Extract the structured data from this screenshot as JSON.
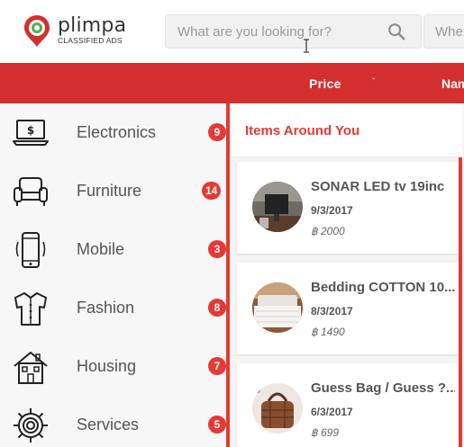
{
  "brand": {
    "name": "plimpa",
    "tagline": "CLASSIFIED ADS"
  },
  "search": {
    "placeholder": "What are you looking for?",
    "location_placeholder": "Where"
  },
  "sortbar": {
    "price_label": "Price",
    "name_label": "Name"
  },
  "categories": [
    {
      "label": "Electronics",
      "count": "9",
      "icon": "laptop-icon"
    },
    {
      "label": "Furniture",
      "count": "14",
      "icon": "sofa-icon"
    },
    {
      "label": "Mobile",
      "count": "3",
      "icon": "mobile-phone-icon"
    },
    {
      "label": "Fashion",
      "count": "8",
      "icon": "shirt-icon"
    },
    {
      "label": "Housing",
      "count": "7",
      "icon": "house-icon"
    },
    {
      "label": "Services",
      "count": "5",
      "icon": "gear-icon"
    }
  ],
  "main": {
    "title": "Items Around You",
    "items": [
      {
        "title": "SONAR LED tv 19inc",
        "date": "9/3/2017",
        "price": "฿ 2000"
      },
      {
        "title": "Bedding COTTON 10...",
        "date": "8/3/2017",
        "price": "฿ 1490"
      },
      {
        "title": "Guess Bag / Guess ?...",
        "date": "6/3/2017",
        "price": "฿ 699"
      }
    ]
  },
  "colors": {
    "accent": "#d32f2f",
    "badge": "#e53935"
  }
}
